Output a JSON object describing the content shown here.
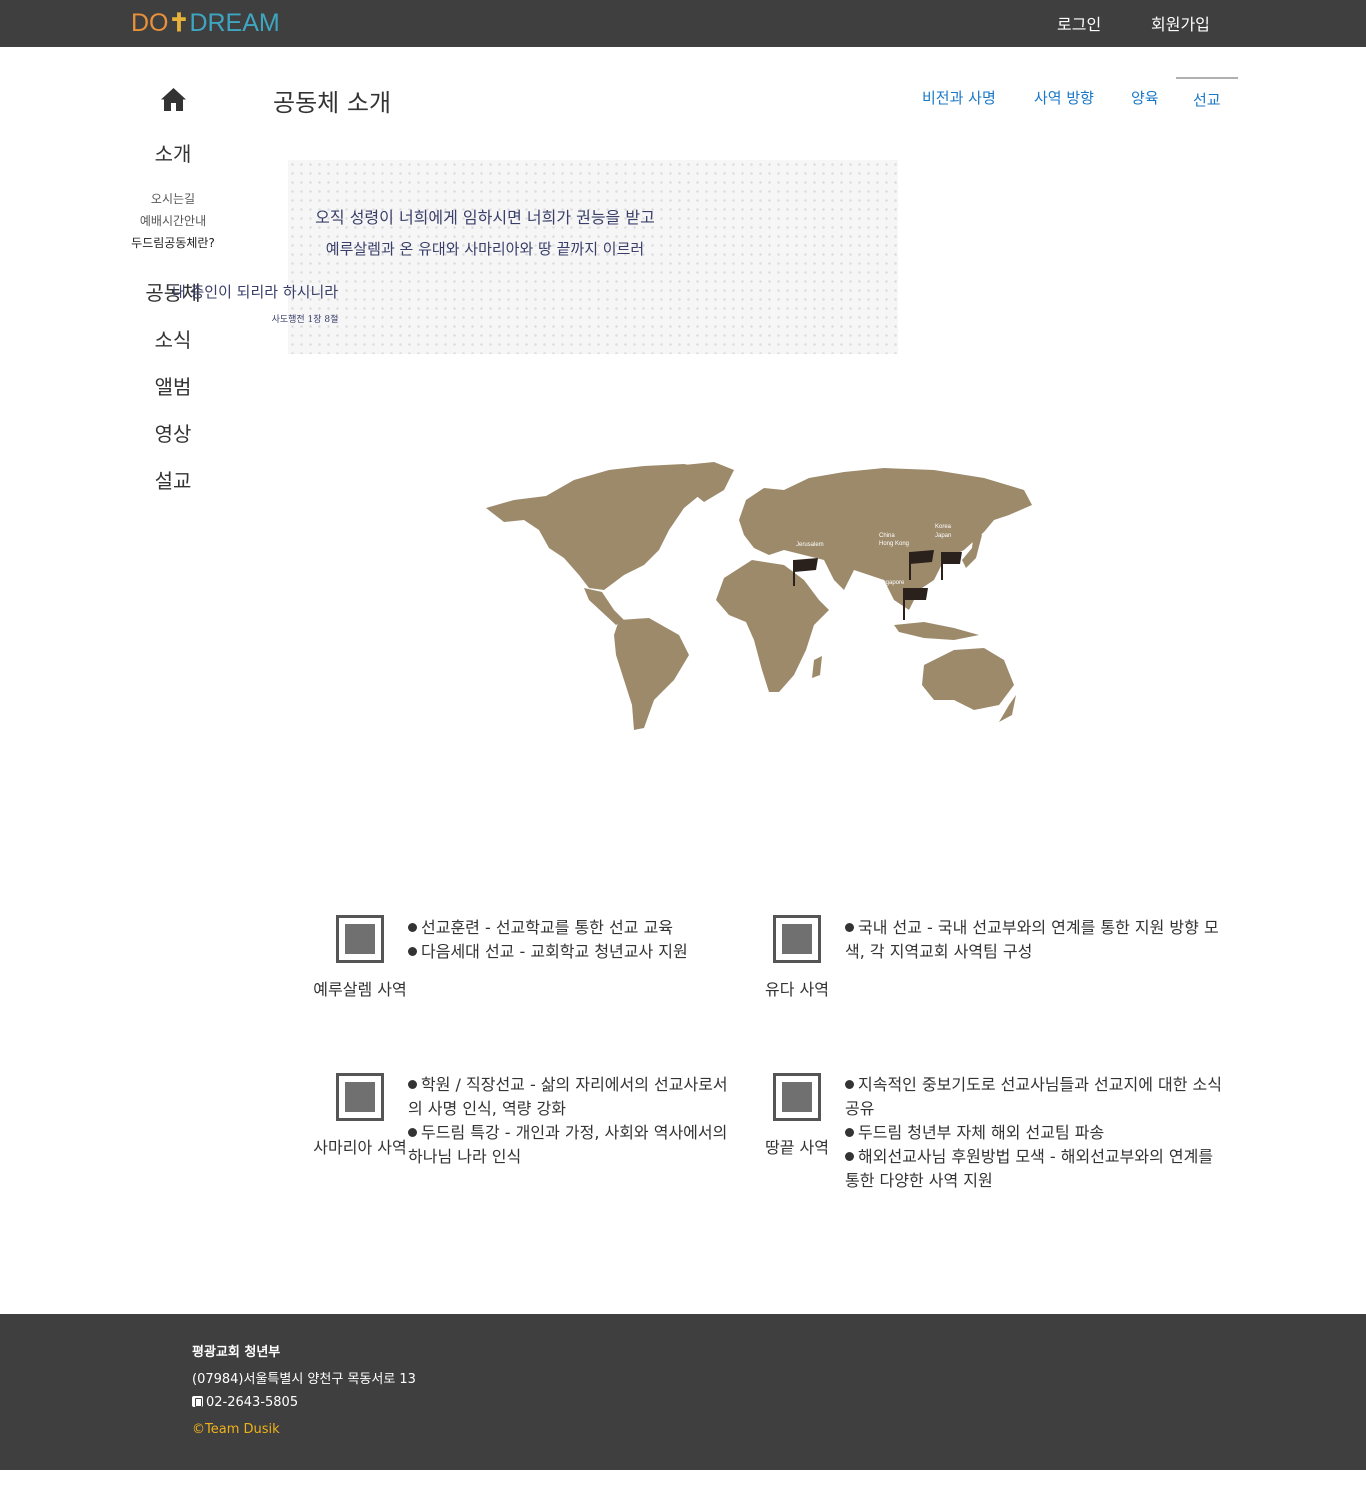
{
  "navbar": {
    "logo": {
      "part1": "DO",
      "cross": "✝",
      "part2": "DREAM"
    },
    "login": "로그인",
    "signup": "회원가입"
  },
  "sidebar": {
    "home_icon": "home-icon",
    "intro": "소개",
    "intro_sub": [
      "오시는길",
      "예배시간안내",
      "두드림공동체란?"
    ],
    "items": [
      "공동체",
      "소식",
      "앨범",
      "영상",
      "설교"
    ]
  },
  "page": {
    "title": "공동체 소개",
    "tabs": [
      "비전과 사명",
      "사역 방향",
      "양육",
      "선교"
    ],
    "active_tab": "선교"
  },
  "banner": {
    "line1": "오직 성령이 너희에게 임하시면 너희가 권능을 받고",
    "line2": "예루살렘과 온 유대와 사마리아와 땅 끝까지 이르러",
    "line3": "내 증인이 되리라 하시니라",
    "ref": "사도행전 1장 8절"
  },
  "map": {
    "labels": [
      "Jerusalem",
      "China",
      "Hong Kong",
      "Korea",
      "Japan",
      "Singapore"
    ],
    "land_color": "#9c8a6b"
  },
  "ministries": [
    {
      "label": "예루살렘 사역",
      "items": [
        "선교훈련 - 선교학교를 통한 선교 교육",
        "다음세대 선교 - 교회학교 청년교사 지원"
      ]
    },
    {
      "label": "유다 사역",
      "items": [
        "국내 선교 - 국내 선교부와의 연계를 통한 지원 방향 모색, 각 지역교회 사역팀 구성"
      ]
    },
    {
      "label": "사마리아 사역",
      "items": [
        "학원 / 직장선교 - 삶의 자리에서의 선교사로서의 사명 인식, 역량 강화",
        "두드림 특강 - 개인과 가정, 사회와 역사에서의 하나님 나라 인식"
      ]
    },
    {
      "label": "땅끝 사역",
      "items": [
        "지속적인 중보기도로 선교사님들과 선교지에 대한 소식 공유",
        "두드림 청년부 자체 해외 선교팀 파송",
        "해외선교사님 후원방법 모색 - 해외선교부와의 연계를 통한 다양한 사역 지원"
      ]
    }
  ],
  "footer": {
    "org": "평광교회 청년부",
    "address": "(07984)서울특별시 양천구 목동서로 13",
    "phone": "02-2643-5805",
    "copyright": "©Team Dusik"
  }
}
